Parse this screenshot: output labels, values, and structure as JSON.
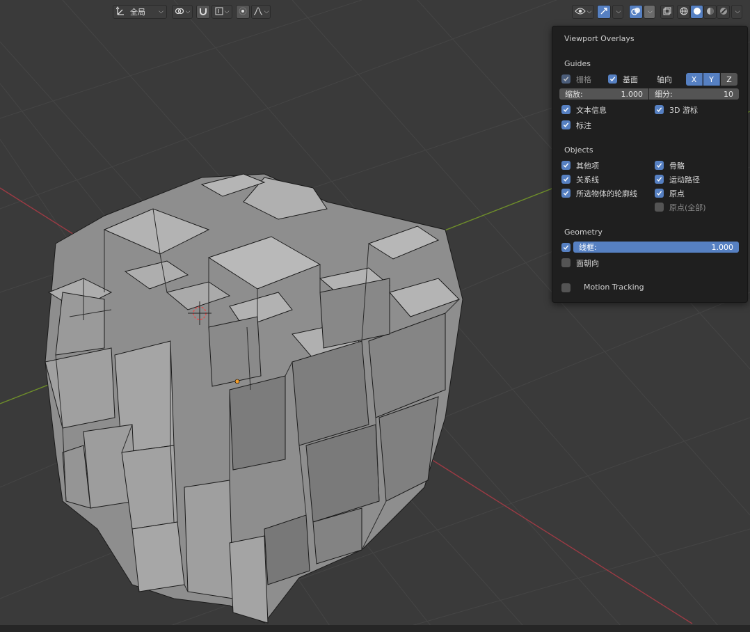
{
  "header": {
    "orientation_label": "全局"
  },
  "overlays": {
    "title": "Viewport Overlays",
    "guides": {
      "heading": "Guides",
      "grid_label": "栅格",
      "floor_label": "基面",
      "axes_label": "轴向",
      "axis_x": "X",
      "axis_y": "Y",
      "axis_z": "Z",
      "scale_label": "缩放:",
      "scale_value": "1.000",
      "subdiv_label": "细分:",
      "subdiv_value": "10",
      "text_info_label": "文本信息",
      "cursor3d_label": "3D 游标",
      "annotations_label": "标注"
    },
    "objects": {
      "heading": "Objects",
      "extras_label": "其他项",
      "bones_label": "骨骼",
      "relationship_label": "关系线",
      "motion_paths_label": "运动路径",
      "outline_label": "所选物体的轮廓线",
      "origins_label": "原点",
      "origins_all_label": "原点(全部)"
    },
    "geometry": {
      "heading": "Geometry",
      "wireframe_label": "线框:",
      "wireframe_value": "1.000",
      "face_orientation_label": "面朝向"
    },
    "motion_tracking_label": "Motion Tracking"
  },
  "colors": {
    "accent": "#5680c2",
    "background": "#3a3a3a",
    "x_axis": "#9c3a44",
    "y_axis": "#6f8f2a",
    "panel": "#1f1f1f"
  }
}
